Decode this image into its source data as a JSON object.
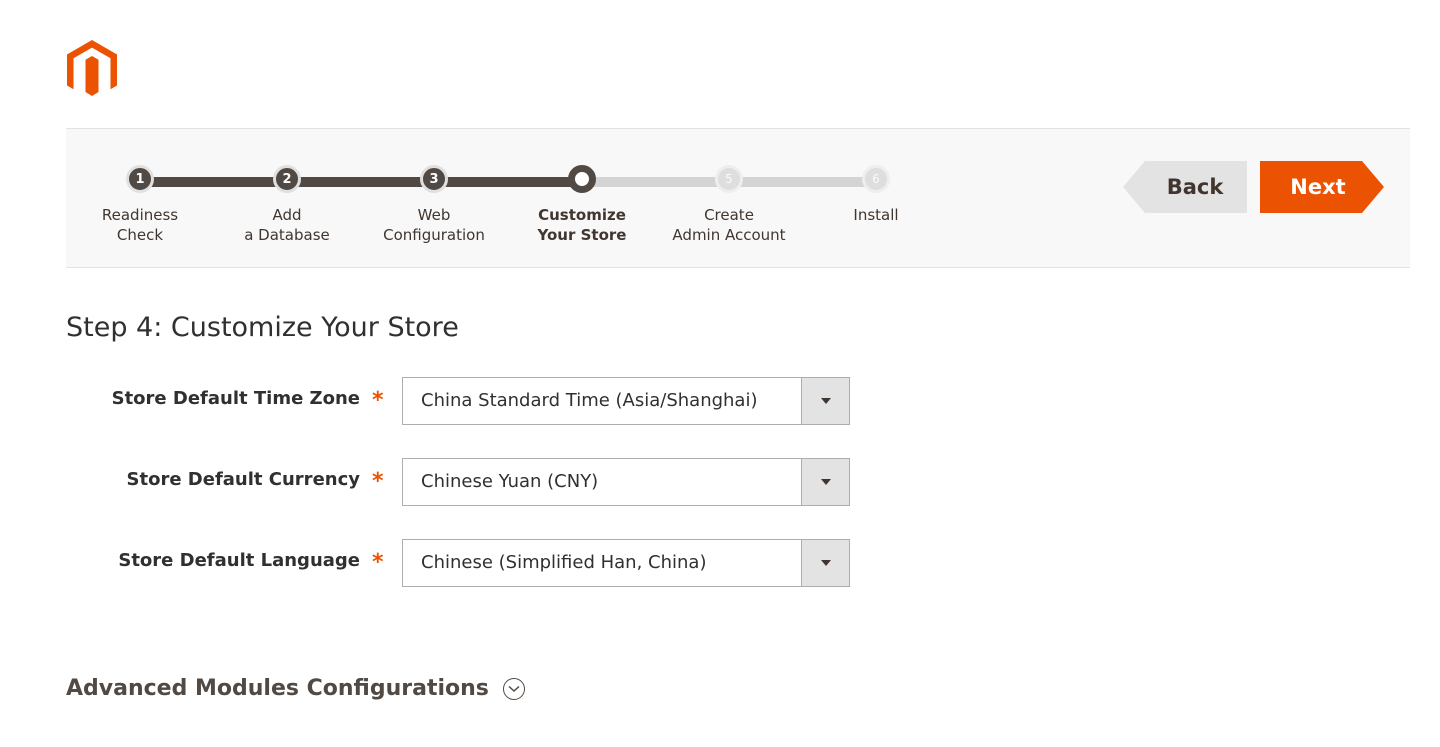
{
  "colors": {
    "accent": "#eb5202",
    "dark": "#514943",
    "inactive": "#d4d4d4"
  },
  "logo": {
    "icon": "magento-logo-icon"
  },
  "wizard": {
    "steps": [
      {
        "number": "1",
        "label": "Readiness\nCheck",
        "state": "done"
      },
      {
        "number": "2",
        "label": "Add\na Database",
        "state": "done"
      },
      {
        "number": "3",
        "label": "Web\nConfiguration",
        "state": "done"
      },
      {
        "number": "",
        "label": "Customize\nYour Store",
        "state": "current"
      },
      {
        "number": "5",
        "label": "Create\nAdmin Account",
        "state": "todo"
      },
      {
        "number": "6",
        "label": "Install",
        "state": "todo"
      }
    ],
    "back_label": "Back",
    "next_label": "Next"
  },
  "page": {
    "title": "Step 4: Customize Your Store",
    "fields": [
      {
        "label": "Store Default Time Zone",
        "required": "*",
        "value": "China Standard Time (Asia/Shanghai)"
      },
      {
        "label": "Store Default Currency",
        "required": "*",
        "value": "Chinese Yuan (CNY)"
      },
      {
        "label": "Store Default Language",
        "required": "*",
        "value": "Chinese (Simplified Han, China)"
      }
    ],
    "advanced_label": "Advanced Modules Configurations"
  }
}
